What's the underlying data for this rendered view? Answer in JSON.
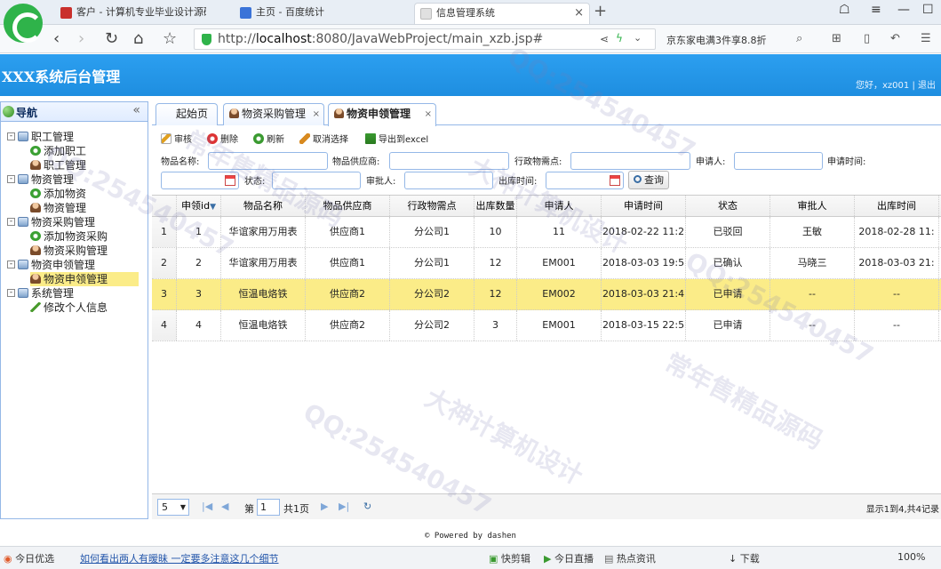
{
  "browser": {
    "tabs": [
      {
        "title": "客户 - 计算机专业毕业设计源码",
        "fav": "#c9302c"
      },
      {
        "title": "主页 - 百度统计",
        "fav": "#3a73d8"
      },
      {
        "title": "信息管理系统",
        "fav": "#e0e0e0"
      }
    ],
    "url_prefix": "http://",
    "url_host": "localhost",
    "url_rest": ":8080/JavaWebProject/main_xzb.jsp#",
    "promo": "京东家电满3件享8.8折"
  },
  "app": {
    "title": "XXX系统后台管理",
    "greeting": "您好，",
    "user": "xz001",
    "separator": " | ",
    "logout": "退出"
  },
  "sidebar": {
    "title": "导航",
    "groups": [
      {
        "label": "职工管理",
        "items": [
          {
            "label": "添加职工",
            "icon": "add-icon"
          },
          {
            "label": "职工管理",
            "icon": "user-icon"
          }
        ]
      },
      {
        "label": "物资管理",
        "items": [
          {
            "label": "添加物资",
            "icon": "add-icon"
          },
          {
            "label": "物资管理",
            "icon": "user-icon"
          }
        ]
      },
      {
        "label": "物资采购管理",
        "items": [
          {
            "label": "添加物资采购",
            "icon": "add-icon"
          },
          {
            "label": "物资采购管理",
            "icon": "user-icon"
          }
        ]
      },
      {
        "label": "物资申领管理",
        "items": [
          {
            "label": "物资申领管理",
            "icon": "user-icon",
            "selected": true
          }
        ]
      },
      {
        "label": "系统管理",
        "items": [
          {
            "label": "修改个人信息",
            "icon": "edit-icon"
          }
        ]
      }
    ]
  },
  "main_tabs": [
    {
      "label": "起始页",
      "closable": false
    },
    {
      "label": "物资采购管理",
      "closable": true
    },
    {
      "label": "物资申领管理",
      "closable": true,
      "active": true
    }
  ],
  "toolbar": {
    "audit": "审核",
    "delete": "删除",
    "refresh": "刷新",
    "cancel_select": "取消选择",
    "export": "导出到excel"
  },
  "search": {
    "name_label": "物品名称:",
    "supplier_label": "物品供应商:",
    "point_label": "行政物需点:",
    "applicant_label": "申请人:",
    "apply_time_label": "申请时间:",
    "status_label": "状态:",
    "approver_label": "审批人:",
    "out_time_label": "出库时间:",
    "query": "查询"
  },
  "grid": {
    "columns": [
      "申领id",
      "物品名称",
      "物品供应商",
      "行政物需点",
      "出库数量",
      "申请人",
      "申请时间",
      "状态",
      "审批人",
      "出库时间"
    ],
    "rows": [
      {
        "num": "1",
        "cells": [
          "1",
          "华谊家用万用表",
          "供应商1",
          "分公司1",
          "10",
          "11",
          "2018-02-22 11:2",
          "已驳回",
          "王敏",
          "2018-02-28 11:"
        ]
      },
      {
        "num": "2",
        "cells": [
          "2",
          "华谊家用万用表",
          "供应商1",
          "分公司1",
          "12",
          "EM001",
          "2018-03-03 19:5",
          "已确认",
          "马晓三",
          "2018-03-03 21:"
        ]
      },
      {
        "num": "3",
        "cells": [
          "3",
          "恒温电烙铁",
          "供应商2",
          "分公司2",
          "12",
          "EM002",
          "2018-03-03 21:4",
          "已申请",
          "--",
          "--"
        ],
        "highlight": true
      },
      {
        "num": "4",
        "cells": [
          "4",
          "恒温电烙铁",
          "供应商2",
          "分公司2",
          "3",
          "EM001",
          "2018-03-15 22:5",
          "已申请",
          "--",
          "--"
        ]
      }
    ]
  },
  "pager": {
    "page_size": "5",
    "page_label": "第",
    "page_value": "1",
    "page_total": "共1页",
    "info": "显示1到4,共4记录"
  },
  "footer": "© Powered by dashen",
  "statusbar": {
    "left": "今日优选",
    "headline": "如何看出两人有暧昧 一定要多注意这几个细节",
    "items": [
      "快剪辑",
      "今日直播",
      "热点资讯",
      "下载",
      "100%"
    ]
  },
  "watermark": [
    "QQ:254540457",
    "常年售精品源码",
    "大神计算机设计"
  ]
}
